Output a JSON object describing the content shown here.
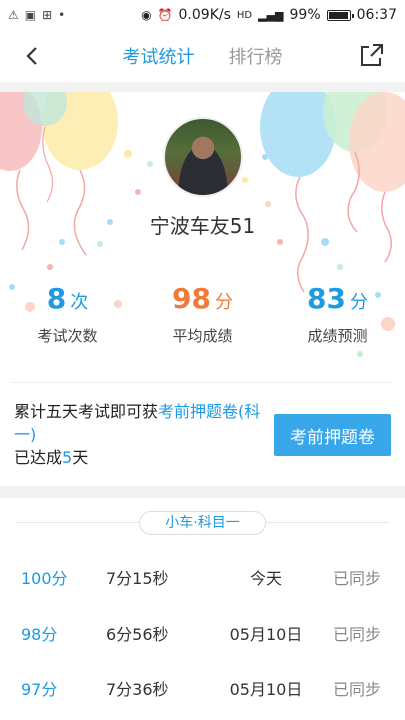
{
  "statusbar": {
    "speed": "0.09K/s",
    "network": "HD",
    "battery": "99%",
    "time": "06:37"
  },
  "nav": {
    "tabs": [
      {
        "label": "考试统计",
        "active": true
      },
      {
        "label": "排行榜",
        "active": false
      }
    ]
  },
  "profile": {
    "username": "宁波车友51"
  },
  "stats": [
    {
      "value": "8",
      "unit": "次",
      "label": "考试次数",
      "color": "#1e9be0"
    },
    {
      "value": "98",
      "unit": "分",
      "label": "平均成绩",
      "color": "#f07b38"
    },
    {
      "value": "83",
      "unit": "分",
      "label": "成绩预测",
      "color": "#1e9be0"
    }
  ],
  "promo": {
    "text_prefix": "累计五天考试即可获",
    "link": "考前押题卷(科一)",
    "achieved_prefix": "已达成",
    "achieved_days": "5",
    "achieved_suffix": "天",
    "button": "考前押题卷"
  },
  "records": {
    "category": "小车·科目一",
    "rows": [
      {
        "score": "100分",
        "duration": "7分15秒",
        "date": "今天",
        "status": "已同步"
      },
      {
        "score": "98分",
        "duration": "6分56秒",
        "date": "05月10日",
        "status": "已同步"
      },
      {
        "score": "97分",
        "duration": "7分36秒",
        "date": "05月10日",
        "status": "已同步"
      }
    ]
  },
  "colors": {
    "accent": "#1e9be0",
    "orange": "#f07b38"
  }
}
